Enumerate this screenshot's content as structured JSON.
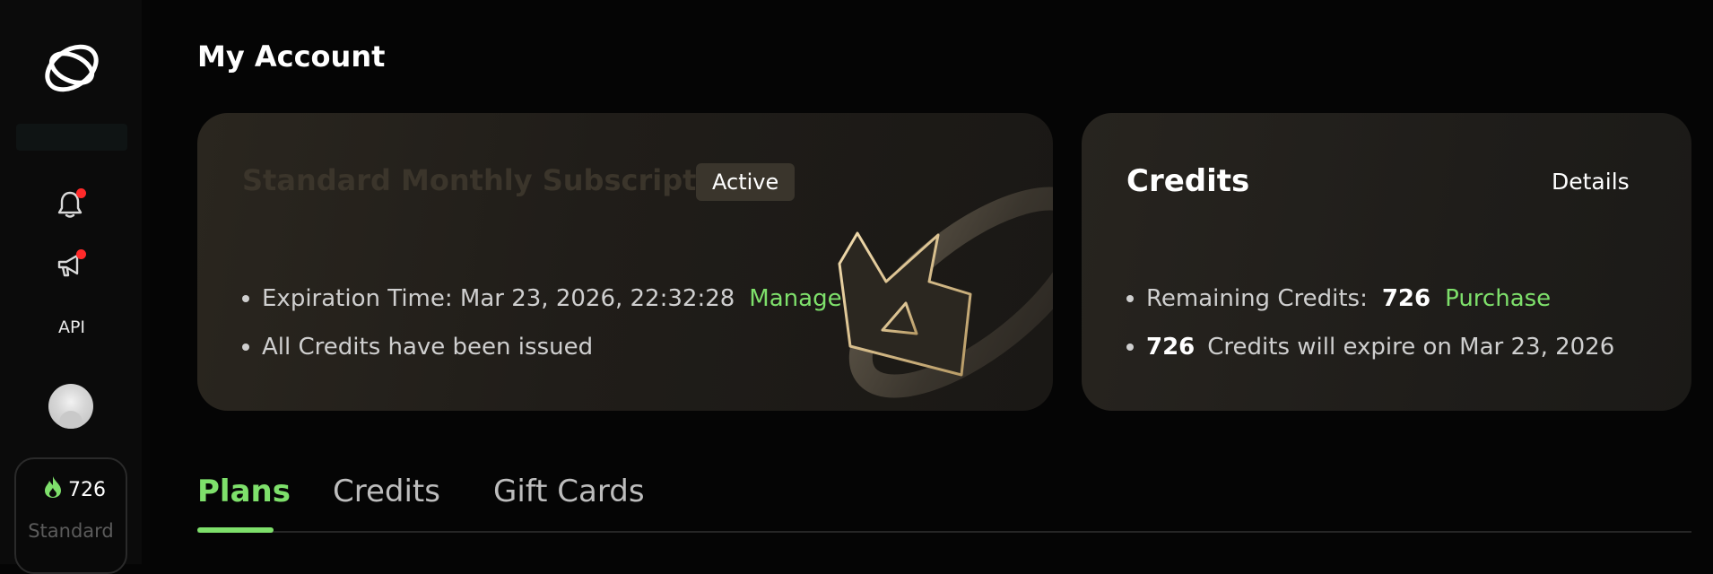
{
  "sidebar": {
    "api_label": "API",
    "credit_count": "726",
    "plan_label": "Standard",
    "notification_dot_color": "#ff2a2a"
  },
  "page": {
    "title": "My Account"
  },
  "subscription": {
    "title": "Standard Monthly Subscription",
    "status": "Active",
    "expiration_text": "Expiration Time: Mar 23, 2026, 22:32:28",
    "manage_label": "Manage",
    "issued_text": "All Credits have been issued"
  },
  "credits": {
    "title": "Credits",
    "details_label": "Details",
    "remaining_label": "Remaining Credits:",
    "remaining_value": "726",
    "purchase_label": "Purchase",
    "expire_value": "726",
    "expire_text": "Credits will expire on Mar 23, 2026"
  },
  "tabs": [
    {
      "label": "Plans",
      "active": true
    },
    {
      "label": "Credits",
      "active": false
    },
    {
      "label": "Gift Cards",
      "active": false
    }
  ],
  "colors": {
    "accent": "#7ee06b",
    "background": "#050505",
    "card": "#221f1b"
  }
}
